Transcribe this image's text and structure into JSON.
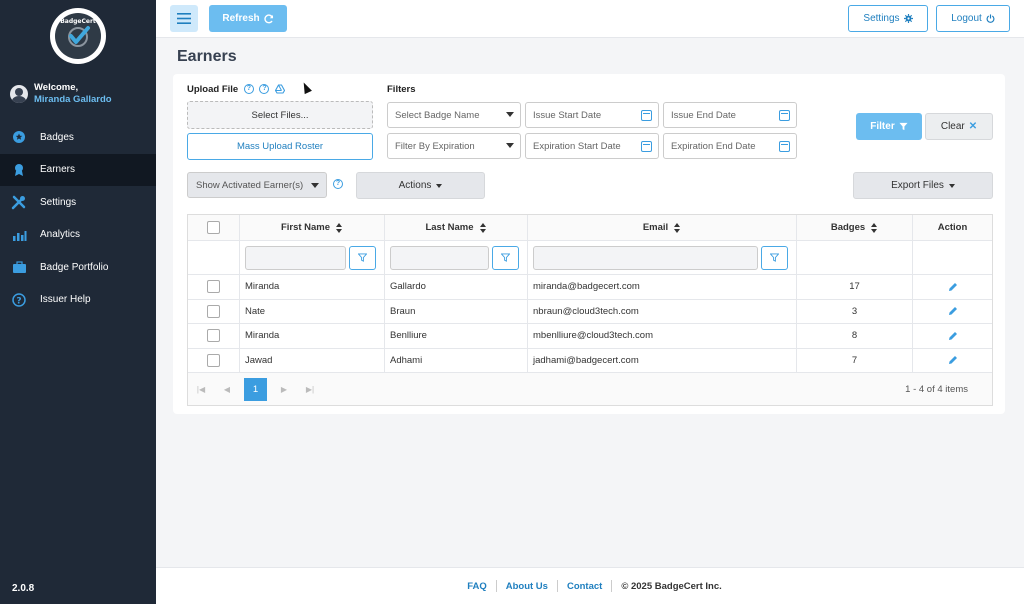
{
  "app": {
    "logo_text": "BadgeCert",
    "version": "2.0.8"
  },
  "user": {
    "welcome": "Welcome,",
    "name": "Miranda Gallardo"
  },
  "sidebar": {
    "items": [
      {
        "label": "Badges",
        "icon": "badge-icon"
      },
      {
        "label": "Earners",
        "icon": "earner-icon",
        "active": true
      },
      {
        "label": "Settings",
        "icon": "tools-icon"
      },
      {
        "label": "Analytics",
        "icon": "analytics-icon"
      },
      {
        "label": "Badge Portfolio",
        "icon": "briefcase-icon"
      },
      {
        "label": "Issuer Help",
        "icon": "help-circle-icon"
      }
    ]
  },
  "topbar": {
    "refresh": "Refresh",
    "settings": "Settings",
    "logout": "Logout"
  },
  "page": {
    "title": "Earners"
  },
  "upload": {
    "label": "Upload File",
    "select_files": "Select Files...",
    "mass_upload": "Mass Upload Roster"
  },
  "filters": {
    "label": "Filters",
    "badge_name": "Select Badge Name",
    "issue_start": "Issue Start Date",
    "issue_end": "Issue End Date",
    "expiration": "Filter By Expiration",
    "exp_start": "Expiration Start Date",
    "exp_end": "Expiration End Date",
    "filter_btn": "Filter",
    "clear_btn": "Clear"
  },
  "actions": {
    "activated": "Show Activated Earner(s)",
    "actions_btn": "Actions",
    "export_btn": "Export Files"
  },
  "table": {
    "headers": {
      "first": "First Name",
      "last": "Last Name",
      "email": "Email",
      "badges": "Badges",
      "action": "Action"
    },
    "rows": [
      {
        "first": "Miranda",
        "last": "Gallardo",
        "email": "miranda@badgecert.com",
        "badges": "17"
      },
      {
        "first": "Nate",
        "last": "Braun",
        "email": "nbraun@cloud3tech.com",
        "badges": "3"
      },
      {
        "first": "Miranda",
        "last": "Benlliure",
        "email": "mbenlliure@cloud3tech.com",
        "badges": "8"
      },
      {
        "first": "Jawad",
        "last": "Adhami",
        "email": "jadhami@badgecert.com",
        "badges": "7"
      }
    ],
    "page": "1",
    "items_info": "1 - 4 of 4 items"
  },
  "footer": {
    "faq": "FAQ",
    "about": "About Us",
    "contact": "Contact",
    "copyright": "© 2025 BadgeCert Inc."
  },
  "colors": {
    "accent": "#6cbdf0",
    "sidebar": "#1f2937",
    "link": "#1f7fbf"
  }
}
